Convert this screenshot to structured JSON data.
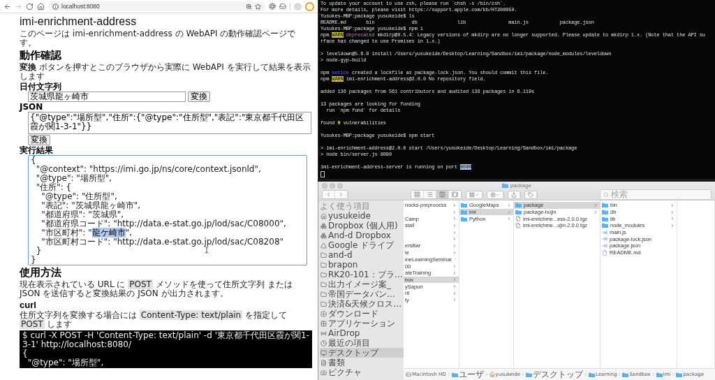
{
  "browser": {
    "nav_buttons": [
      {
        "kind": "back",
        "disabled": false
      },
      {
        "kind": "forward",
        "disabled": true
      },
      {
        "kind": "reload",
        "disabled": false
      },
      {
        "kind": "home",
        "disabled": false
      }
    ],
    "url": "localhost:8080",
    "page": {
      "title": "imi-enrichment-address",
      "intro": "このページは imi-enrichment-address の WebAPI の動作確認ページです。",
      "heading_demo": "動作確認",
      "demo_text": "**変換** ボタンを押すとこのブラウザから実際に WebAPI を実行して結果を表示します",
      "address_label": "日付文字列",
      "address_input": {
        "value": "茨城県龍ヶ崎市"
      },
      "address_button": "変換",
      "json_label": "JSON",
      "json_input": {
        "value": "{\"@type\":\"場所型\",\"住所\":{\"@type\":\"住所型\",\"表記\":\"東京都千代田区霞が関1-3-1\"}}"
      },
      "json_button": "変換",
      "result_label": "実行結果",
      "result": {
        "focused": true,
        "lines": [
          "{",
          "  \"@context\": \"https://imi.go.jp/ns/core/context.jsonld\",",
          "  \"@type\": \"場所型\",",
          "  \"住所\": {",
          "    \"@type\": \"住所型\",",
          "    \"表記\": \"茨城県龍ヶ崎市\",",
          "    \"都道府県\": \"茨城県\",",
          "    \"都道府県コード\": \"http://data.e-stat.go.jp/lod/sac/C08000\",",
          [
            {
              "text": "    \"市区町村\": \"",
              "kind": "plain"
            },
            {
              "text": "龍ケ崎市",
              "kind": "selected"
            },
            {
              "text": "\",",
              "kind": "plain"
            }
          ],
          "    \"市区町村コード\": \"http://data.e-stat.go.jp/lod/sac/C08208\"",
          "  }",
          "}"
        ]
      },
      "heading_usage": "使用方法",
      "usage_text": [
        {
          "text": "現在表示されている URL に ",
          "kind": "plain"
        },
        {
          "text": "POST",
          "kind": "code"
        },
        {
          "text": " メソッドを使って住所文字列 または JSON を送信すると変換結果の JSON が出力されます。",
          "kind": "plain"
        }
      ],
      "heading_curl": "curl",
      "curl_text": [
        {
          "text": "住所文字列を変換する場合には ",
          "kind": "plain"
        },
        {
          "text": "Content-Type: text/plain",
          "kind": "code"
        },
        {
          "text": " を指定して ",
          "kind": "plain"
        },
        {
          "text": "POST",
          "kind": "code"
        },
        {
          "text": " します",
          "kind": "plain"
        }
      ],
      "code_lines": [
        "$ curl -X POST -H 'Content-Type: text/plain' -d '東京都千代田区霞が関1-3-1' http://localhost:8080/",
        "{",
        "  \"@type\": \"場所型\","
      ]
    }
  },
  "terminal": {
    "blocks": [
      [
        "To update your account to use zsh, please run `chsh -s /bin/zsh`.",
        "For more details, please visit https://support.apple.com/kb/HT208050.",
        "Yusukes-MBP:package yusukeide$ ls",
        "README.md       bin             db              lib               main.js           package.json",
        "Yusukes-MBP:package yusukeide$ npm i",
        [
          {
            "text": "npm ",
            "kind": "plain"
          },
          {
            "text": "WARN",
            "kind": "warn"
          },
          {
            "text": " deprecated",
            "kind": "deprecated"
          },
          {
            "text": " mkdirp@0.5.4: Legacy versions of mkdirp are no longer supported. Please update to mkdirp 1.x. (Note that the API su",
            "kind": "plain"
          }
        ],
        "rface has changed to use Promises in 1.x.)"
      ],
      [
        "> leveldown@5.6.0 install /Users/yusukeide/Desktop/Learning/Sandbox/imi/package/node_modules/leveldown",
        "> node-gyp-build"
      ],
      [
        [
          {
            "text": "npm ",
            "kind": "plain"
          },
          {
            "text": "notice",
            "kind": "notice"
          },
          {
            "text": " created a lockfile as package-lock.json. You should commit this file.",
            "kind": "plain"
          }
        ],
        [
          {
            "text": "npm ",
            "kind": "plain"
          },
          {
            "text": "WARN",
            "kind": "warn"
          },
          {
            "text": " imi-enrichment-address@2.0.0 No repository field.",
            "kind": "plain"
          }
        ]
      ],
      [
        "added 136 packages from 561 contributors and audited 136 packages in 6.119s"
      ],
      [
        "13 packages are looking for funding",
        "  run `npm fund` for details"
      ],
      [
        [
          {
            "text": "found ",
            "kind": "plain"
          },
          {
            "text": "0",
            "kind": "bold"
          },
          {
            "text": " vulnerabilities",
            "kind": "plain"
          }
        ]
      ],
      [
        "Yusukes-MBP:package yusukeide$ npm start"
      ],
      [
        "> imi-enrichment-address@2.0.0 start /Users/yusukeide/Desktop/Learning/Sandbox/imi/package",
        "> node bin/server.js 8080"
      ],
      [
        [
          {
            "text": "imi-enrichment-address-server is running on port ",
            "kind": "plain"
          },
          {
            "text": "8080",
            "kind": "selected"
          }
        ]
      ]
    ]
  },
  "finder": {
    "title": "package",
    "view_buttons": [
      {
        "kind": "icons",
        "selected": false
      },
      {
        "kind": "list",
        "selected": false
      },
      {
        "kind": "columns",
        "selected": true
      },
      {
        "kind": "gallery",
        "selected": false
      }
    ],
    "search": {
      "placeholder": "検索"
    },
    "sidebar": {
      "heading": "よく使う項目",
      "items": [
        {
          "label": "yusukeide",
          "kind": "home",
          "selected": false
        },
        {
          "label": "Dropbox (個人用)",
          "kind": "dropbox",
          "selected": false
        },
        {
          "label": "And-d Dropbox",
          "kind": "dropbox",
          "selected": false
        },
        {
          "label": "Google ドライブ",
          "kind": "drive",
          "selected": false
        },
        {
          "label": "and-d",
          "kind": "folder",
          "selected": false
        },
        {
          "label": "brapon",
          "kind": "folder",
          "selected": false
        },
        {
          "label": "RK20-101：ブラ…",
          "kind": "folder",
          "selected": false
        },
        {
          "label": "出力イメージ案_",
          "kind": "folder",
          "selected": false
        },
        {
          "label": "帝国データバン…",
          "kind": "folder",
          "selected": false
        },
        {
          "label": "決済&天候クロス…",
          "kind": "folder",
          "selected": false
        },
        {
          "label": "ダウンロード",
          "kind": "download",
          "selected": false
        },
        {
          "label": "アプリケーション",
          "kind": "apps",
          "selected": false
        },
        {
          "label": "AirDrop",
          "kind": "airdrop",
          "selected": false
        },
        {
          "label": "最近の項目",
          "kind": "recent",
          "selected": false
        },
        {
          "label": "デスクトップ",
          "kind": "desktop",
          "selected": true
        },
        {
          "label": "書類",
          "kind": "documents",
          "selected": false
        },
        {
          "label": "ピクチャ",
          "kind": "pictures",
          "selected": false
        }
      ]
    },
    "columns": [
      {
        "items": [
          {
            "name": "nocks-preprocess",
            "kind": "cut_folder",
            "selected": false
          },
          {
            "kind": "cut_folder",
            "selected": false
          },
          {
            "name": "Camp",
            "kind": "cut_folder",
            "selected": false
          },
          {
            "name": "stall",
            "kind": "cut_folder",
            "selected": false
          },
          {
            "kind": "cut_folder",
            "selected": false
          },
          {
            "kind": "cut_folder",
            "selected": false
          },
          {
            "name": "ersBar",
            "kind": "cut_folder",
            "selected": false
          },
          {
            "name": "le",
            "kind": "cut_folder",
            "selected": false
          },
          {
            "name": "ineLearningSeminar",
            "kind": "cut_folder",
            "selected": false
          },
          {
            "name": "00",
            "kind": "cut_folder",
            "selected": false
          },
          {
            "name": "ateTraining",
            "kind": "cut_folder",
            "selected": false
          },
          {
            "name": "box",
            "kind": "cut_folder",
            "selected": true
          },
          {
            "name": "ySapuri",
            "kind": "cut_folder",
            "selected": false
          },
          {
            "name": "rit",
            "kind": "cut_folder",
            "selected": false
          },
          {
            "name": "ty",
            "kind": "cut_folder",
            "selected": false
          }
        ]
      },
      {
        "items": [
          {
            "name": "GoogleMaps",
            "kind": "folder",
            "selected": false
          },
          {
            "name": "imi",
            "kind": "folder",
            "selected": true
          },
          {
            "name": "Python",
            "kind": "folder",
            "selected": false
          }
        ]
      },
      {
        "items": [
          {
            "name": "package",
            "kind": "folder",
            "selected": true
          },
          {
            "name": "package-hojin",
            "kind": "folder",
            "selected": false
          },
          {
            "name": "imi-enrichme...ess-2.0.0.tgz",
            "kind": "archive",
            "selected": false
          },
          {
            "name": "imi-enrichme...ojin-2.0.0.tgz",
            "kind": "archive",
            "selected": false
          }
        ]
      },
      {
        "items": [
          {
            "name": "bin",
            "kind": "folder",
            "selected": false
          },
          {
            "name": "db",
            "kind": "folder",
            "selected": false
          },
          {
            "name": "lib",
            "kind": "folder",
            "selected": false
          },
          {
            "name": "node_modules",
            "kind": "folder",
            "selected": false
          },
          {
            "name": "main.js",
            "kind": "script",
            "selected": false
          },
          {
            "name": "package-lock.json",
            "kind": "script",
            "selected": false
          },
          {
            "name": "package.json",
            "kind": "script",
            "selected": false
          },
          {
            "name": "README.md",
            "kind": "file",
            "selected": false
          }
        ]
      }
    ],
    "path": [
      {
        "label": "Macintosh HD",
        "kind": "disk"
      },
      {
        "label": "ユーザ",
        "kind": "folder"
      },
      {
        "label": "yusukeide",
        "kind": "home"
      },
      {
        "label": "デスクトップ",
        "kind": "folder"
      },
      {
        "label": "Learning",
        "kind": "folder"
      },
      {
        "label": "Sandbox",
        "kind": "folder"
      },
      {
        "label": "imi",
        "kind": "folder"
      },
      {
        "label": "package",
        "kind": "folder"
      }
    ]
  }
}
